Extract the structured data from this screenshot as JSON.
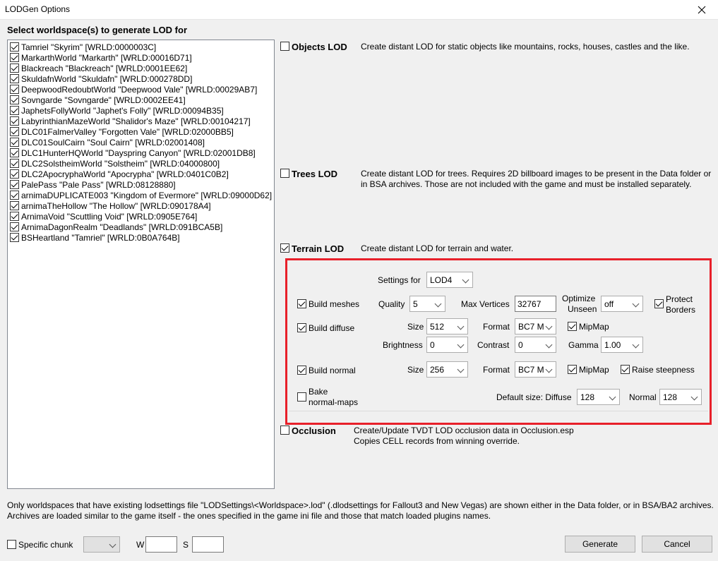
{
  "window": {
    "title": "LODGen Options"
  },
  "worldspaces": {
    "header": "Select worldspace(s) to generate LOD for",
    "items": [
      {
        "label": "Tamriel \"Skyrim\" [WRLD:0000003C]",
        "checked": true
      },
      {
        "label": "MarkarthWorld \"Markarth\" [WRLD:00016D71]",
        "checked": true
      },
      {
        "label": "Blackreach \"Blackreach\" [WRLD:0001EE62]",
        "checked": true
      },
      {
        "label": "SkuldafnWorld \"Skuldafn\" [WRLD:000278DD]",
        "checked": true
      },
      {
        "label": "DeepwoodRedoubtWorld \"Deepwood Vale\" [WRLD:00029AB7]",
        "checked": true
      },
      {
        "label": "Sovngarde \"Sovngarde\" [WRLD:0002EE41]",
        "checked": true
      },
      {
        "label": "JaphetsFollyWorld \"Japhet's Folly\" [WRLD:00094B35]",
        "checked": true
      },
      {
        "label": "LabyrinthianMazeWorld \"Shalidor's Maze\" [WRLD:00104217]",
        "checked": true
      },
      {
        "label": "DLC01FalmerValley \"Forgotten Vale\" [WRLD:02000BB5]",
        "checked": true
      },
      {
        "label": "DLC01SoulCairn \"Soul Cairn\" [WRLD:02001408]",
        "checked": true
      },
      {
        "label": "DLC1HunterHQWorld \"Dayspring Canyon\" [WRLD:02001DB8]",
        "checked": true
      },
      {
        "label": "DLC2SolstheimWorld \"Solstheim\" [WRLD:04000800]",
        "checked": true
      },
      {
        "label": "DLC2ApocryphaWorld \"Apocrypha\" [WRLD:0401C0B2]",
        "checked": true
      },
      {
        "label": "PalePass \"Pale Pass\" [WRLD:08128880]",
        "checked": true
      },
      {
        "label": "arnimaDUPLICATE003 \"Kingdom of Evermore\" [WRLD:09000D62]",
        "checked": true
      },
      {
        "label": "arnimaTheHollow \"The Hollow\" [WRLD:090178A4]",
        "checked": true
      },
      {
        "label": "ArnimaVoid \"Scuttling Void\" [WRLD:0905E764]",
        "checked": true
      },
      {
        "label": "ArnimaDagonRealm \"Deadlands\" [WRLD:091BCA5B]",
        "checked": true
      },
      {
        "label": "BSHeartland \"Tamriel\" [WRLD:0B0A764B]",
        "checked": true
      }
    ]
  },
  "objects": {
    "label": "Objects LOD",
    "checked": false,
    "desc": "Create distant LOD for static objects like mountains, rocks, houses, castles and the like."
  },
  "trees": {
    "label": "Trees LOD",
    "checked": false,
    "desc1": "Create distant LOD for trees. Requires 2D billboard images to be present in the Data folder or",
    "desc2": "in BSA archives. Those are not included with the game and must be installed separately."
  },
  "terrain": {
    "label": "Terrain LOD",
    "checked": true,
    "desc": "Create distant LOD for terrain and water.",
    "settings_for_label": "Settings for",
    "settings_for_value": "LOD4",
    "build_meshes": "Build meshes",
    "quality_label": "Quality",
    "quality_value": "5",
    "max_vertices_label": "Max Vertices",
    "max_vertices_value": "32767",
    "optimize_label1": "Optimize",
    "optimize_label2": "Unseen",
    "optimize_value": "off",
    "protect_label1": "Protect",
    "protect_label2": "Borders",
    "build_diffuse": "Build diffuse",
    "size_label": "Size",
    "diffuse_size": "512",
    "format_label": "Format",
    "diffuse_format": "BC7 M",
    "mipmap_label": "MipMap",
    "brightness_label": "Brightness",
    "brightness_value": "0",
    "contrast_label": "Contrast",
    "contrast_value": "0",
    "gamma_label": "Gamma",
    "gamma_value": "1.00",
    "build_normal": "Build normal",
    "normal_size": "256",
    "normal_format": "BC7 M",
    "raise_steepness": "Raise steepness",
    "bake_label1": "Bake",
    "bake_label2": "normal-maps",
    "default_size_label": "Default size: Diffuse",
    "default_diffuse": "128",
    "normal_label": "Normal",
    "default_normal": "128"
  },
  "occlusion": {
    "label": "Occlusion",
    "checked": false,
    "desc1": "Create/Update TVDT LOD occlusion data in Occlusion.esp",
    "desc2": "Copies CELL records from winning override."
  },
  "footer": {
    "note1": "Only worldspaces that have existing lodsettings file \"LODSettings\\<Worldspace>.lod\" (.dlodsettings for Fallout3 and New Vegas) are shown either in the Data folder, or in BSA/BA2 archives.",
    "note2": "Archives are loaded similar to the game itself - the ones specified in the game ini file and those that match loaded plugins names.",
    "specific_chunk": "Specific chunk",
    "w_label": "W",
    "s_label": "S",
    "generate": "Generate",
    "cancel": "Cancel"
  },
  "colors": {
    "highlight": "#e8202a",
    "background": "#f0f0f0"
  }
}
